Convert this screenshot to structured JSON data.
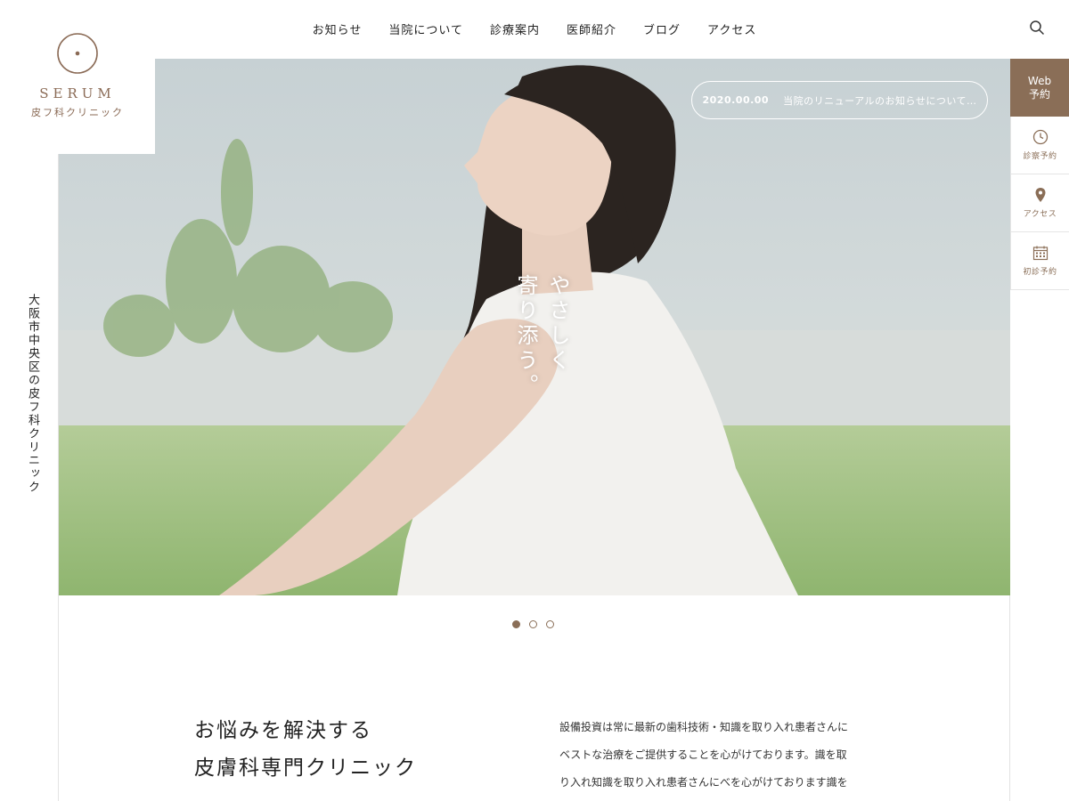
{
  "brand": {
    "name": "SERUM",
    "subtitle": "皮フ科クリニック"
  },
  "nav": {
    "items": [
      "お知らせ",
      "当院について",
      "診療案内",
      "医師紹介",
      "ブログ",
      "アクセス"
    ],
    "search_icon": "search-icon"
  },
  "left_vertical_text": "大阪市中央区の皮フ科クリニック",
  "hero": {
    "copy_line1": "やさしく",
    "copy_line2": "寄り添う。",
    "news_date": "2020.00.00",
    "news_title": "当院のリニューアルのお知らせについて…"
  },
  "sidepanel": {
    "web_line1": "Web",
    "web_line2": "予約",
    "items": [
      {
        "label": "診察予約",
        "icon": "clock-icon"
      },
      {
        "label": "アクセス",
        "icon": "map-pin-icon"
      },
      {
        "label": "初診予約",
        "icon": "calendar-icon"
      }
    ]
  },
  "slider": {
    "count": 3,
    "active": 1
  },
  "intro": {
    "heading_line1": "お悩みを解決する",
    "heading_line2": "皮膚科専門クリニック",
    "body_lines": [
      "設備投資は常に最新の歯科技術・知識を取り入れ患者さんに",
      "ベストな治療をご提供することを心がけております。識を取",
      "り入れ知識を取り入れ患者さんにべを心がけております識を"
    ]
  },
  "colors": {
    "accent": "#8a6e57",
    "text": "#222222"
  }
}
